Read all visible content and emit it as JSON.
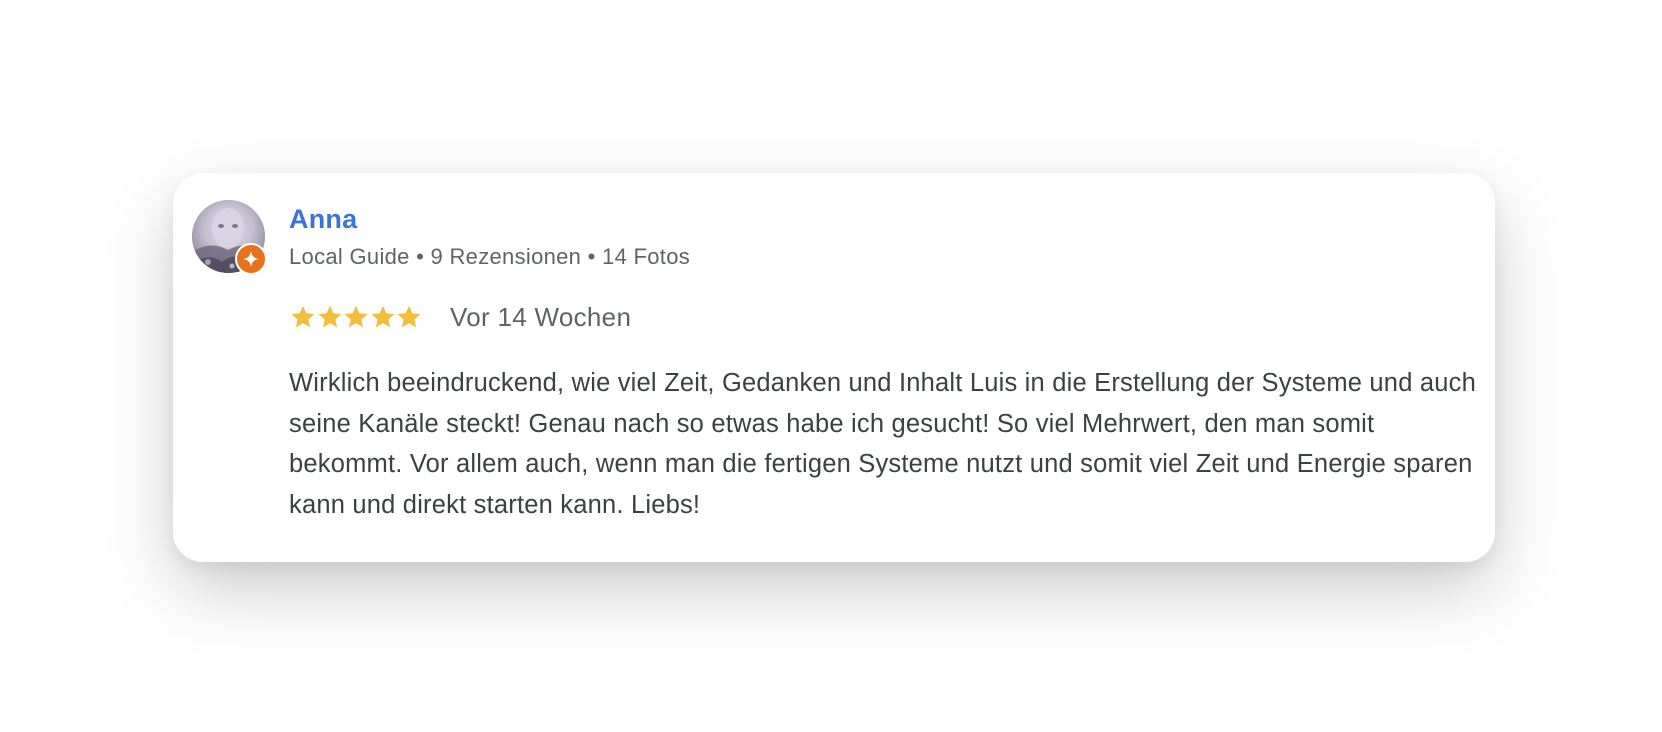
{
  "review": {
    "reviewer_name": "Anna",
    "reviewer_meta": "Local Guide • 9 Rezensionen • 14 Fotos",
    "rating": 5,
    "rating_max": 5,
    "date": "Vor 14 Wochen",
    "text": "Wirklich beeindruckend, wie viel Zeit, Gedanken und Inhalt Luis in die Erstellung der Systeme und auch seine Kanäle steckt! Genau nach so etwas habe ich gesucht! So viel Mehrwert, den man somit bekommt. Vor allem auch, wenn man die fertigen Systeme nutzt und somit viel Zeit und Energie sparen kann und direkt starten kann. Liebs!",
    "avatar_icon": "avatar-photo",
    "badge_icon": "local-guide-star-icon",
    "star_icon": "star-icon"
  },
  "colors": {
    "name": "#3c74d6",
    "meta": "#5f6368",
    "star": "#f4be3d",
    "body_text": "#3c4043",
    "badge": "#e8711c"
  }
}
